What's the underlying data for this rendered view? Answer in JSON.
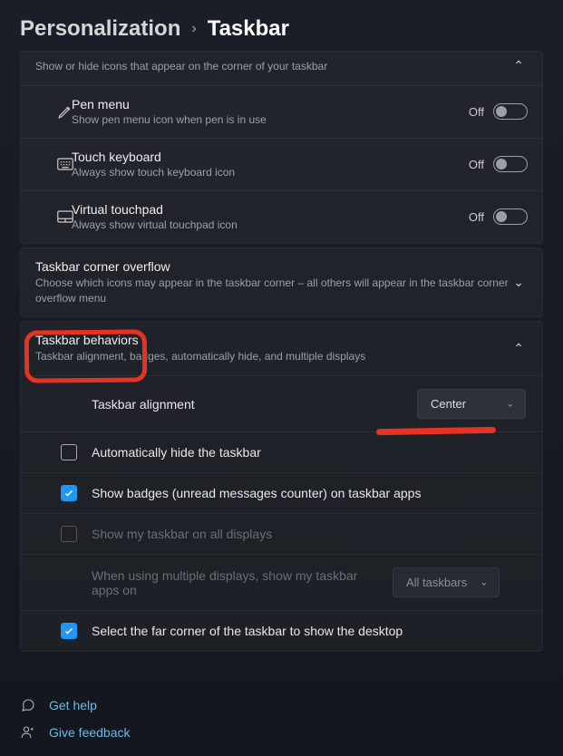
{
  "breadcrumb": {
    "parent": "Personalization",
    "current": "Taskbar"
  },
  "cornerIcons": {
    "sub": "Show or hide icons that appear on the corner of your taskbar",
    "items": [
      {
        "title": "Pen menu",
        "sub": "Show pen menu icon when pen is in use",
        "state": "Off"
      },
      {
        "title": "Touch keyboard",
        "sub": "Always show touch keyboard icon",
        "state": "Off"
      },
      {
        "title": "Virtual touchpad",
        "sub": "Always show virtual touchpad icon",
        "state": "Off"
      }
    ]
  },
  "overflow": {
    "title": "Taskbar corner overflow",
    "sub": "Choose which icons may appear in the taskbar corner – all others will appear in the taskbar corner overflow menu"
  },
  "behaviors": {
    "title": "Taskbar behaviors",
    "sub": "Taskbar alignment, badges, automatically hide, and multiple displays",
    "alignmentLabel": "Taskbar alignment",
    "alignmentValue": "Center",
    "autoHide": "Automatically hide the taskbar",
    "badges": "Show badges (unread messages counter) on taskbar apps",
    "allDisplays": "Show my taskbar on all displays",
    "multiLabel": "When using multiple displays, show my taskbar apps on",
    "multiValue": "All taskbars",
    "farCorner": "Select the far corner of the taskbar to show the desktop"
  },
  "footer": {
    "help": "Get help",
    "feedback": "Give feedback"
  }
}
